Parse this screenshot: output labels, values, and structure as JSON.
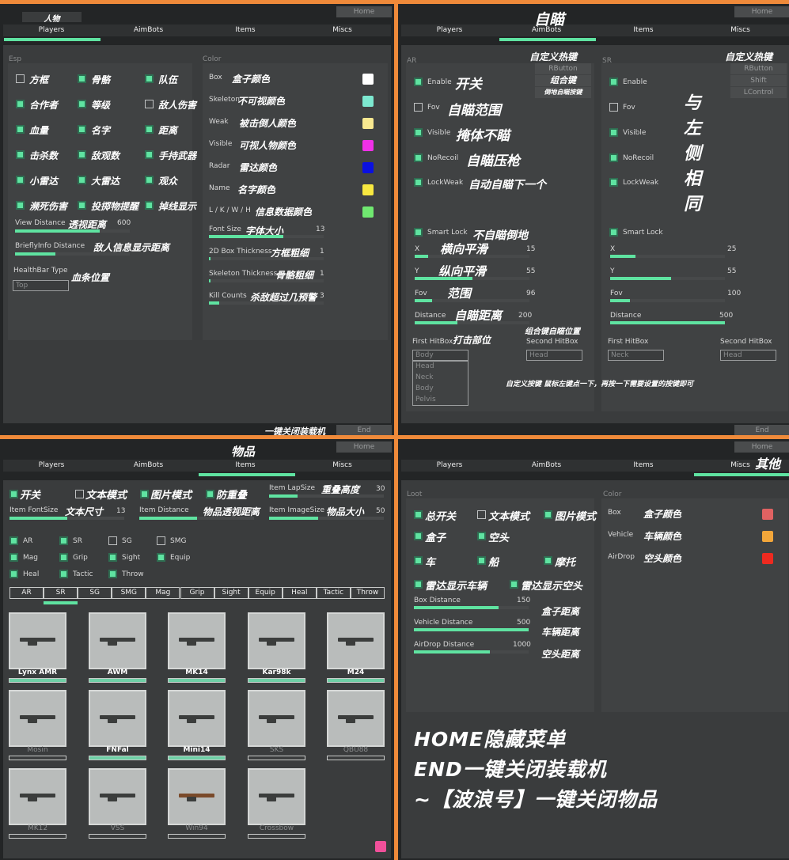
{
  "tabs": [
    "Players",
    "AimBots",
    "Items",
    "Miscs"
  ],
  "home_label": "Home",
  "end_label": "End",
  "accent_color": "#5fe3a1",
  "players": {
    "title": "人物",
    "esp_label": "Esp",
    "color_label": "Color",
    "esp_checks": [
      {
        "label": "方框",
        "checked": false
      },
      {
        "label": "骨骼",
        "checked": true
      },
      {
        "label": "队伍",
        "checked": true
      },
      {
        "label": "合作者",
        "checked": true
      },
      {
        "label": "等级",
        "checked": true
      },
      {
        "label": "敌人伤害",
        "checked": false
      },
      {
        "label": "血量",
        "checked": true
      },
      {
        "label": "名字",
        "checked": true
      },
      {
        "label": "距离",
        "checked": true
      },
      {
        "label": "击杀数",
        "checked": true
      },
      {
        "label": "敌观数",
        "checked": true
      },
      {
        "label": "手持武器",
        "checked": true
      },
      {
        "label": "小雷达",
        "checked": true
      },
      {
        "label": "大雷达",
        "checked": true
      },
      {
        "label": "观众",
        "checked": true
      },
      {
        "label": "濒死伤害",
        "checked": true
      },
      {
        "label": "投掷物提醒",
        "checked": true
      },
      {
        "label": "掉线显示",
        "checked": true
      }
    ],
    "esp_sliders": [
      {
        "label": "View Distance",
        "note": "透视距离",
        "value": "600",
        "fill": 0.74
      },
      {
        "label": "BrieflyInfo Distance",
        "note": "敌人信息显示距离",
        "fill": 0.35
      }
    ],
    "healthbar": {
      "label": "HealthBar Type",
      "note": "血条位置",
      "value": "Top"
    },
    "colors": [
      {
        "label": "Box",
        "note": "盒子颜色",
        "color": "#ffffff"
      },
      {
        "label": "Skeleton",
        "note": "不可视颜色",
        "color": "#7de8d0"
      },
      {
        "label": "Weak",
        "note": "被击倒人颜色",
        "color": "#f8e890"
      },
      {
        "label": "Visible",
        "note": "可视人物颜色",
        "color": "#f030e8"
      },
      {
        "label": "Radar",
        "note": "雷达颜色",
        "color": "#0a10e0"
      },
      {
        "label": "Name",
        "note": "名字颜色",
        "color": "#f8e840"
      },
      {
        "label": "L / K / W / H",
        "note": "信息数据颜色",
        "color": "#70e870"
      }
    ],
    "color_sliders": [
      {
        "label": "Font Size",
        "note": "字体大小",
        "value": "13",
        "fill": 0.65
      },
      {
        "label": "2D Box Thickness",
        "note": "方框粗细",
        "value": "1",
        "fill": 0.01
      },
      {
        "label": "Skeleton Thickness",
        "note": "骨骼粗细",
        "value": "1",
        "fill": 0.01
      },
      {
        "label": "Kill Counts",
        "note": "杀敌超过几预警",
        "value": "3",
        "fill": 0.09
      }
    ],
    "end_note": "一键关闭装载机"
  },
  "aimbots": {
    "title": "自瞄",
    "note": "自定义按键 鼠标左键点一下，再按一下需要设置的按键即可",
    "groups": [
      {
        "label": "AR",
        "hotkey_title": "自定义热键",
        "hotkeys": [
          "RButton",
          "组合键",
          "倒地自瞄按键"
        ],
        "checks": [
          {
            "label": "Enable",
            "note": "开关",
            "checked": true
          },
          {
            "label": "Fov",
            "note": "自瞄范围",
            "checked": false
          },
          {
            "label": "Visible",
            "note": "掩体不瞄",
            "checked": true
          },
          {
            "label": "NoRecoil",
            "note": "自瞄压枪",
            "checked": true
          },
          {
            "label": "LockWeak",
            "note": "自动自瞄下一个",
            "checked": true
          },
          {
            "label": "Smart Lock",
            "note": "不自瞄倒地",
            "checked": true
          }
        ],
        "sliders": [
          {
            "label": "X",
            "note": "横向平滑",
            "value": "15",
            "fill": 0.12
          },
          {
            "label": "Y",
            "note": "纵向平滑",
            "value": "55",
            "fill": 0.5
          },
          {
            "label": "Fov",
            "note": "范围",
            "value": "96",
            "fill": 0.15
          },
          {
            "label": "Distance",
            "note": "自瞄距离",
            "value": "200",
            "fill": 0.37
          }
        ],
        "first_hitbox": {
          "label": "First HitBox",
          "note": "打击部位",
          "value": "Body",
          "options": [
            "Head",
            "Neck",
            "Body",
            "Pelvis"
          ]
        },
        "second_hitbox": {
          "label": "Second HitBox",
          "note": "组合键自瞄位置",
          "value": "Head"
        }
      },
      {
        "label": "SR",
        "hotkey_title": "自定义热键",
        "hotkeys": [
          "RButton",
          "Shift",
          "LControl"
        ],
        "same_note": "与左侧相同",
        "checks": [
          {
            "label": "Enable",
            "checked": true
          },
          {
            "label": "Fov",
            "checked": false
          },
          {
            "label": "Visible",
            "checked": true
          },
          {
            "label": "NoRecoil",
            "checked": true
          },
          {
            "label": "LockWeak",
            "checked": true
          },
          {
            "label": "Smart Lock",
            "checked": true
          }
        ],
        "sliders": [
          {
            "label": "X",
            "value": "25",
            "fill": 0.22
          },
          {
            "label": "Y",
            "value": "55",
            "fill": 0.53
          },
          {
            "label": "Fov",
            "value": "100",
            "fill": 0.17
          },
          {
            "label": "Distance",
            "value": "500",
            "fill": 1.0
          }
        ],
        "first_hitbox": {
          "label": "First HitBox",
          "value": "Neck"
        },
        "second_hitbox": {
          "label": "Second HitBox",
          "value": "Head"
        }
      }
    ]
  },
  "items": {
    "title": "物品",
    "top_checks": [
      {
        "label": "开关",
        "checked": true
      },
      {
        "label": "文本模式",
        "checked": false
      },
      {
        "label": "图片模式",
        "checked": true
      },
      {
        "label": "防重叠",
        "checked": true
      }
    ],
    "sliders": [
      {
        "label": "Item LapSize",
        "note": "重叠高度",
        "value": "30",
        "fill": 0.25
      },
      {
        "label": "Item FontSize",
        "note": "文本尺寸",
        "value": "13",
        "fill": 0.5
      },
      {
        "label": "Item Distance",
        "note": "物品透视距离",
        "value": "0",
        "fill": 0.5
      },
      {
        "label": "Item ImageSize",
        "note": "物品大小",
        "value": "50",
        "fill": 0.43
      }
    ],
    "filters": [
      {
        "label": "AR",
        "checked": true
      },
      {
        "label": "SR",
        "checked": true
      },
      {
        "label": "SG",
        "checked": false
      },
      {
        "label": "SMG",
        "checked": false
      },
      {
        "label": "Mag",
        "checked": true
      },
      {
        "label": "Grip",
        "checked": true
      },
      {
        "label": "Sight",
        "checked": true
      },
      {
        "label": "Equip",
        "checked": true
      },
      {
        "label": "Heal",
        "checked": true
      },
      {
        "label": "Tactic",
        "checked": true
      },
      {
        "label": "Throw",
        "checked": true
      }
    ],
    "category_tabs": [
      "AR",
      "SR",
      "SG",
      "SMG",
      "Mag",
      "Grip",
      "Sight",
      "Equip",
      "Heal",
      "Tactic",
      "Throw"
    ],
    "active_category": 1,
    "weapons": [
      {
        "name": "Lynx AMR",
        "enabled": true
      },
      {
        "name": "AWM",
        "enabled": true
      },
      {
        "name": "MK14",
        "enabled": true
      },
      {
        "name": "Kar98k",
        "enabled": true
      },
      {
        "name": "M24",
        "enabled": true
      },
      {
        "name": "Mosin",
        "enabled": false
      },
      {
        "name": "FNFal",
        "enabled": true
      },
      {
        "name": "Mini14",
        "enabled": true
      },
      {
        "name": "SKS",
        "enabled": false
      },
      {
        "name": "QBU88",
        "enabled": false
      },
      {
        "name": "MK12",
        "enabled": false
      },
      {
        "name": "VSS",
        "enabled": false
      },
      {
        "name": "Win94",
        "enabled": false
      },
      {
        "name": "Crossbow",
        "enabled": false
      }
    ],
    "swatch_color": "#f0509a"
  },
  "miscs": {
    "title": "其他",
    "loot_label": "Loot",
    "color_label": "Color",
    "checks": [
      {
        "label": "总开关",
        "checked": true
      },
      {
        "label": "文本模式",
        "checked": false
      },
      {
        "label": "图片模式",
        "checked": true
      },
      {
        "label": "盒子",
        "checked": true
      },
      {
        "label": "空头",
        "checked": true
      },
      {
        "label": "车",
        "checked": true
      },
      {
        "label": "船",
        "checked": true
      },
      {
        "label": "摩托",
        "checked": true
      },
      {
        "label": "雷达显示车辆",
        "checked": true
      },
      {
        "label": "雷达显示空头",
        "checked": true
      }
    ],
    "sliders": [
      {
        "label": "Box Distance",
        "note": "盒子距离",
        "value": "150",
        "fill": 0.74
      },
      {
        "label": "Vehicle Distance",
        "note": "车辆距离",
        "value": "500",
        "fill": 1.0
      },
      {
        "label": "AirDrop Distance",
        "note": "空头距离",
        "value": "1000",
        "fill": 0.66
      }
    ],
    "colors": [
      {
        "label": "Box",
        "note": "盒子颜色",
        "color": "#e06262"
      },
      {
        "label": "Vehicle",
        "note": "车辆颜色",
        "color": "#f2a63a"
      },
      {
        "label": "AirDrop",
        "note": "空头颜色",
        "color": "#ee2a20"
      }
    ],
    "help_lines": [
      "HOME隐藏菜单",
      "END一键关闭装载机",
      "~【波浪号】一键关闭物品"
    ]
  }
}
